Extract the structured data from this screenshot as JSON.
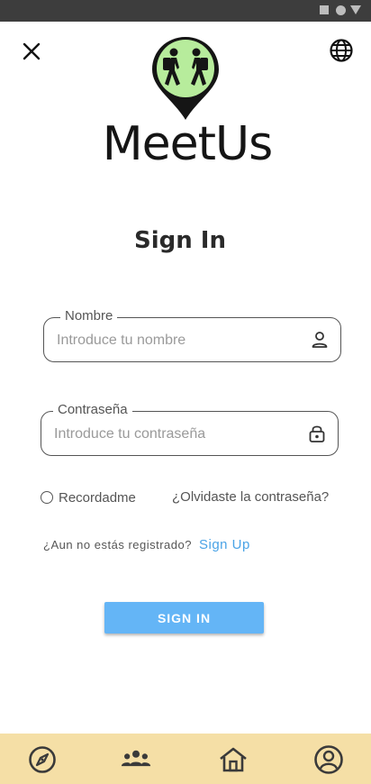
{
  "app": {
    "name": "MeetUs"
  },
  "header": {
    "title": "Sign In"
  },
  "form": {
    "name_label": "Nombre",
    "name_placeholder": "Introduce tu nombre",
    "name_value": "",
    "password_label": "Contraseña",
    "password_placeholder": "Introduce tu contraseña",
    "password_value": "",
    "remember_label": "Recordadme",
    "remember_checked": false,
    "forgot_label": "¿Olvidaste la contraseña?",
    "register_question": "¿Aun no estás registrado?",
    "signup_label": "Sign Up",
    "submit_label": "SIGN IN"
  },
  "colors": {
    "accent": "#64b5f6",
    "link": "#4aa3e6",
    "nav_bg": "#f5dfa6",
    "logo_green": "#b7ec9c"
  },
  "icons": {
    "close": "close-icon",
    "language": "globe-icon",
    "name_field": "person-icon",
    "password_field": "lock-icon"
  },
  "bottom_nav": [
    {
      "id": "explore",
      "icon": "compass-icon"
    },
    {
      "id": "groups",
      "icon": "group-icon"
    },
    {
      "id": "home",
      "icon": "home-icon"
    },
    {
      "id": "profile",
      "icon": "account-circle-icon"
    }
  ]
}
